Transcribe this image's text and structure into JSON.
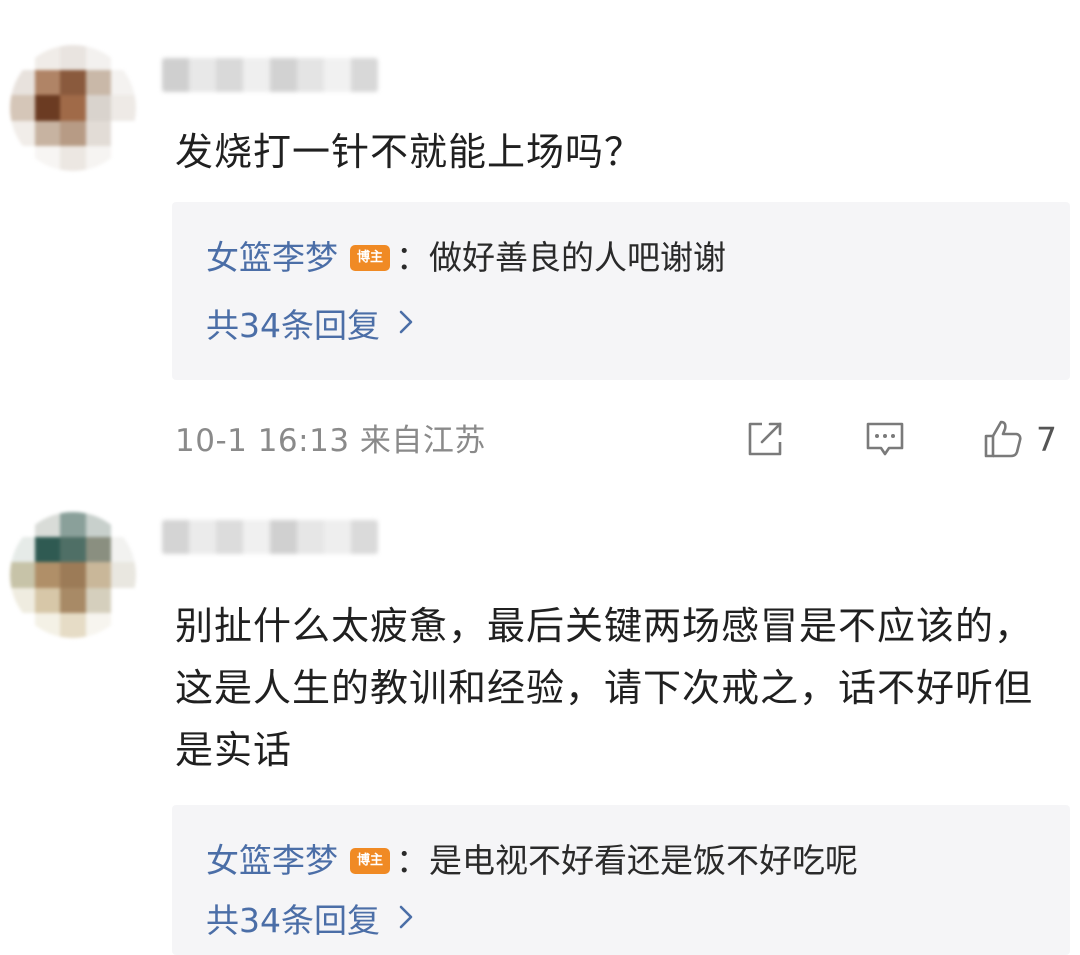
{
  "comments": [
    {
      "text": "发烧打一针不就能上场吗？",
      "reply": {
        "author": "女篮李梦",
        "badge": "博主",
        "text": "：做好善良的人吧谢谢"
      },
      "reply_count": "共34条回复",
      "meta": "10-1 16:13 来自江苏",
      "likes": "7",
      "avatar_colors": [
        "#fff",
        "#f0ece8",
        "#e9e4e0",
        "#f3f1ef",
        "#fff",
        "#e8e2dd",
        "#b08466",
        "#8a5a3d",
        "#c9b8a8",
        "#f4f2f0",
        "#d5c6b8",
        "#6b3b22",
        "#a06a48",
        "#d9d3cd",
        "#eeeae6",
        "#f1ede9",
        "#c7b3a1",
        "#b79b85",
        "#e2dcd6",
        "#fff",
        "#fff",
        "#f7f5f3",
        "#ece7e2",
        "#f6f4f2",
        "#fff"
      ],
      "name_colors": [
        "#cfcfcf",
        "#e8e8e8",
        "#d9d9d9",
        "#efefef",
        "#d2d2d2",
        "#e4e4e4",
        "#f1f1f1",
        "#d8d8d8"
      ]
    },
    {
      "text": "别扯什么太疲惫，最后关键两场感冒是不应该的，这是人生的教训和经验，请下次戒之，话不好听但是实话",
      "reply": {
        "author": "女篮李梦",
        "badge": "博主",
        "text": "：是电视不好看还是饭不好吃呢"
      },
      "reply_count": "共34条回复",
      "avatar_colors": [
        "#fff",
        "#d9dcd8",
        "#8aa09a",
        "#c8d0cc",
        "#fff",
        "#e6ebe8",
        "#2f5a52",
        "#4f6f66",
        "#8a8f80",
        "#f2f2f0",
        "#c7c3a8",
        "#b08f68",
        "#9c7b57",
        "#c9b799",
        "#e9e7e0",
        "#efece0",
        "#d7c7a8",
        "#a88a66",
        "#d5cfbd",
        "#fff",
        "#fff",
        "#f4f1e6",
        "#e6dcc6",
        "#f7f5ef",
        "#fff"
      ],
      "name_colors": [
        "#d4d4d4",
        "#ebebeb",
        "#dcdcdc",
        "#f0f0f0",
        "#d0d0d0",
        "#e6e6e6",
        "#eeeeee",
        "#dadada"
      ]
    }
  ]
}
